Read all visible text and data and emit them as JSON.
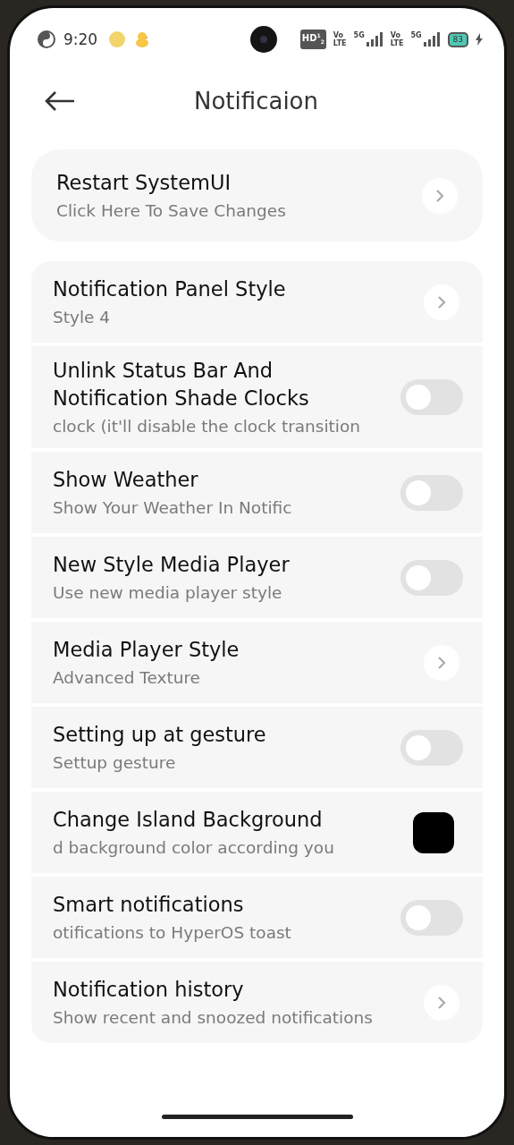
{
  "status_bar": {
    "time": "9:20",
    "hd_badge": "HD$^{1}$$_{2}$",
    "sims": [
      {
        "volte_top": "Vo",
        "volte_bottom": "LTE",
        "network": "5G"
      },
      {
        "volte_top": "Vo",
        "volte_bottom": "LTE",
        "network": "5G"
      }
    ],
    "battery": "83"
  },
  "header": {
    "title": "Notificaion"
  },
  "restart_card": {
    "title": "Restart SystemUI",
    "subtitle": "Click Here To Save Changes"
  },
  "settings": [
    {
      "kind": "arrow",
      "title": "Notification Panel Style",
      "subtitle": "Style 4"
    },
    {
      "kind": "toggle",
      "title": "Unlink Status Bar And Notification Shade Clocks",
      "subtitle": "clock (it'll disable the clock transition",
      "on": false
    },
    {
      "kind": "toggle",
      "title": "Show Weather",
      "subtitle": "Show Your Weather In Notific",
      "on": false
    },
    {
      "kind": "toggle",
      "title": "New Style Media Player",
      "subtitle": "Use new media player style",
      "on": false
    },
    {
      "kind": "arrow",
      "title": "Media Player Style",
      "subtitle": "Advanced Texture"
    },
    {
      "kind": "toggle",
      "title": "Setting up at gesture",
      "subtitle": "Settup gesture",
      "on": false
    },
    {
      "kind": "color",
      "title": "Change Island Background",
      "subtitle": "d background color according you",
      "color": "#000000"
    },
    {
      "kind": "toggle",
      "title": "Smart notifications",
      "subtitle": "otifications to HyperOS toast",
      "on": false
    },
    {
      "kind": "arrow",
      "title": "Notification history",
      "subtitle": "Show recent and snoozed notifications"
    }
  ]
}
